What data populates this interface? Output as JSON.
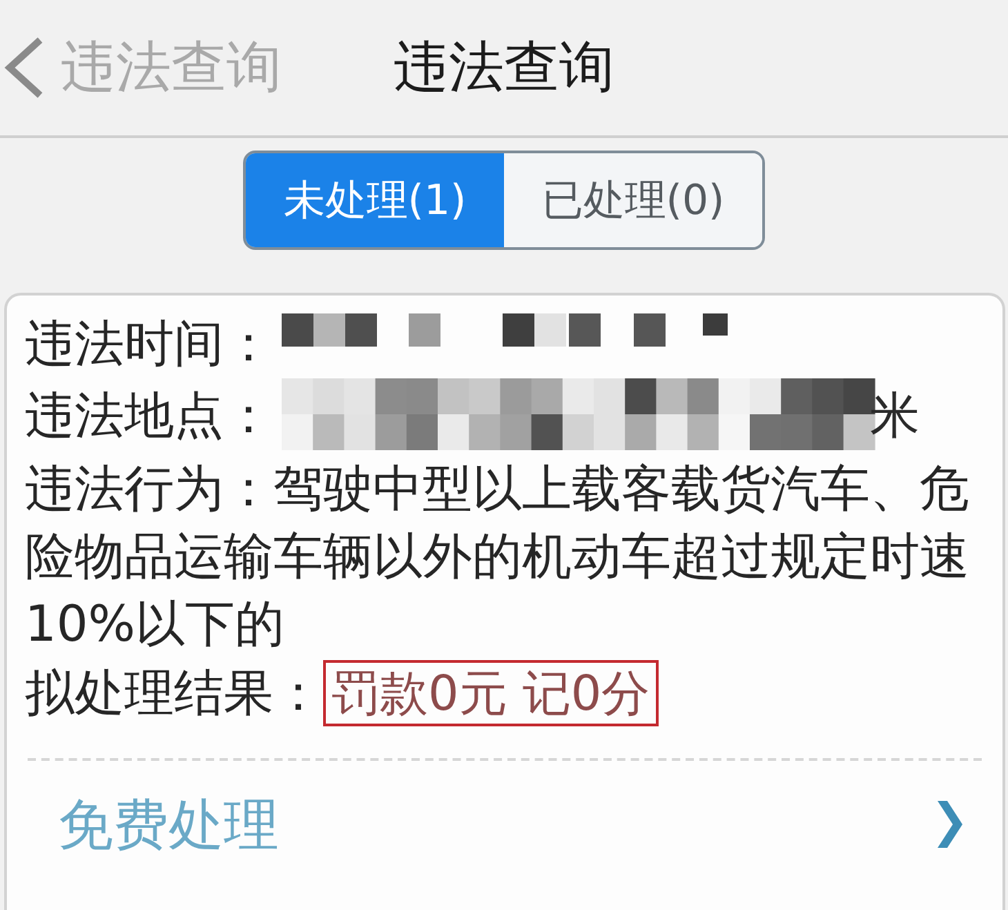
{
  "nav": {
    "back_label": "违法查询",
    "title": "违法查询"
  },
  "tabs": [
    {
      "label": "未处理(1)",
      "selected": true
    },
    {
      "label": "已处理(0)",
      "selected": false
    }
  ],
  "record": {
    "fields": [
      {
        "kind": "redacted",
        "label": "违法时间："
      },
      {
        "kind": "redacted",
        "label": "违法地点：",
        "visible_tail": "米"
      },
      {
        "kind": "paragraph",
        "text": "违法行为：驾驶中型以上载客载货汽车、危险物品运输车辆以外的机动车超过规定时速10%以下的"
      },
      {
        "kind": "boxed",
        "label": "拟处理结果：",
        "value": "罚款0元 记0分"
      }
    ],
    "action": {
      "label": "免费处理"
    }
  }
}
